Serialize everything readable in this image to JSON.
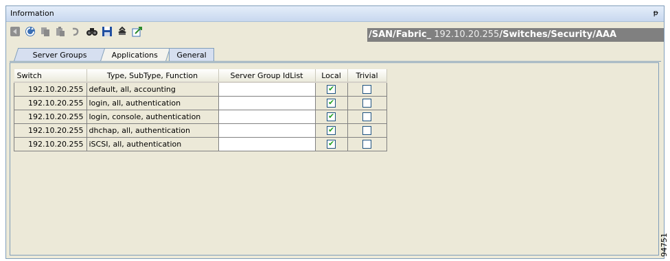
{
  "panel": {
    "title": "Information",
    "pin_glyph": "ᵽ"
  },
  "toolbar": {
    "icons": [
      "back-icon",
      "refresh-icon",
      "copy-icon",
      "paste-icon",
      "undo-icon",
      "find-icon",
      "save-icon",
      "print-icon",
      "export-icon"
    ]
  },
  "path": {
    "prefix": "/SAN/Fabric_",
    "ip": " 192.10.20.255",
    "suffix": "/Switches/Security/AAA"
  },
  "tabs": [
    {
      "label": "Server Groups"
    },
    {
      "label": "Applications"
    },
    {
      "label": "General"
    }
  ],
  "table": {
    "columns": [
      "Switch",
      "Type, SubType, Function",
      "Server Group IdList",
      "Local",
      "Trivial"
    ],
    "rows": [
      {
        "switch": "192.10.20.255",
        "type": "default, all, accounting",
        "server_group": "",
        "local": true,
        "trivial": false
      },
      {
        "switch": "192.10.20.255",
        "type": "login, all, authentication",
        "server_group": "",
        "local": true,
        "trivial": false
      },
      {
        "switch": "192.10.20.255",
        "type": "login, console, authentication",
        "server_group": "",
        "local": true,
        "trivial": false
      },
      {
        "switch": "192.10.20.255",
        "type": "dhchap, all, authentication",
        "server_group": "",
        "local": true,
        "trivial": false
      },
      {
        "switch": "192.10.20.255",
        "type": "iSCSI, all, authentication",
        "server_group": "",
        "local": true,
        "trivial": false
      }
    ]
  },
  "watermark": "94751",
  "colors": {
    "check_green": "#21a121",
    "path_bg": "#808080",
    "panel_bg": "#ece9d8"
  }
}
